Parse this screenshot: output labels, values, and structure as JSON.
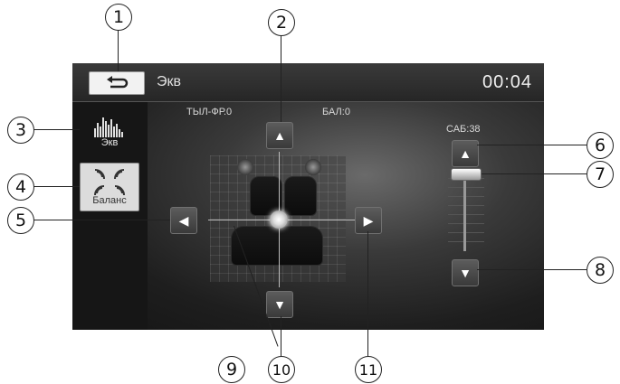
{
  "header": {
    "title": "Экв",
    "time": "00:04"
  },
  "sidebar": {
    "eq_label": "Экв",
    "balance_label": "Баланс"
  },
  "fader": {
    "label": "ТЫЛ-ФР.0",
    "balance": "БАЛ:0"
  },
  "subwoofer": {
    "label": "САБ:38",
    "level_fraction": 1.0
  },
  "callouts": [
    "1",
    "2",
    "3",
    "4",
    "5",
    "6",
    "7",
    "8",
    "9",
    "10",
    "11"
  ],
  "icons": {
    "back": "back-arrow-icon",
    "up": "arrow-up-icon",
    "down": "arrow-down-icon",
    "left": "arrow-left-icon",
    "right": "arrow-right-icon"
  }
}
